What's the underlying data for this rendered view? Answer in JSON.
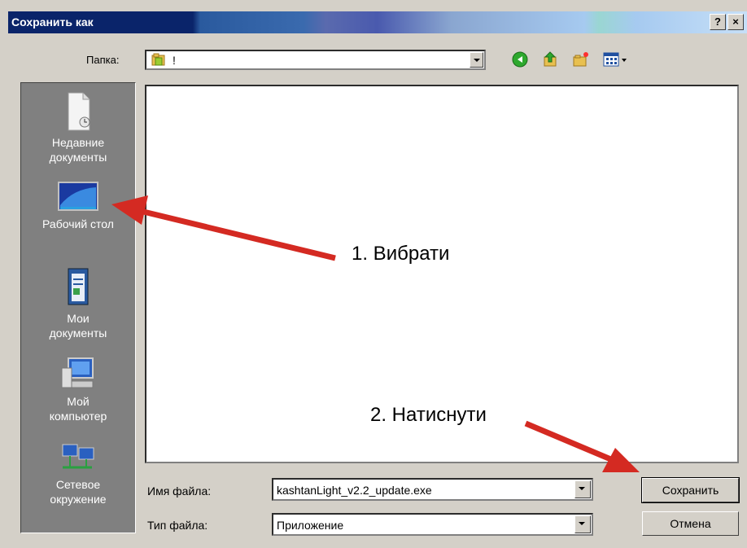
{
  "dialog": {
    "title": "Сохранить как",
    "help_button": "?",
    "close_button": "×"
  },
  "folder": {
    "label": "Папка:",
    "value": "!"
  },
  "places": [
    {
      "label": "Недавние документы",
      "icon": "recent-documents-icon"
    },
    {
      "label": "Рабочий стол",
      "icon": "desktop-icon"
    },
    {
      "label": "Мои документы",
      "icon": "my-documents-icon"
    },
    {
      "label": "Мой компьютер",
      "icon": "my-computer-icon"
    },
    {
      "label": "Сетевое окружение",
      "icon": "network-icon"
    }
  ],
  "filename": {
    "label": "Имя файла:",
    "value": "kashtanLight_v2.2_update.exe"
  },
  "filetype": {
    "label": "Тип файла:",
    "value": "Приложение"
  },
  "buttons": {
    "save": "Сохранить",
    "cancel": "Отмена"
  },
  "annotations": {
    "step1": "1. Вибрати",
    "step2": "2. Натиснути"
  },
  "colors": {
    "title_bar": "#0a246a",
    "dialog_bg": "#d4d0c8",
    "places_bg": "#808080",
    "arrow": "#d42a22"
  }
}
